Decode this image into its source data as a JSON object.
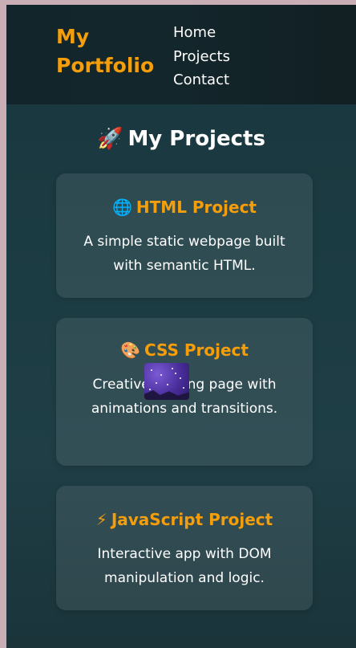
{
  "header": {
    "brand_line1": "My",
    "brand_line2": "Portfolio",
    "nav": [
      "Home",
      "Projects",
      "Contact"
    ]
  },
  "page": {
    "title_emoji": "🚀",
    "title": "My Projects"
  },
  "projects": [
    {
      "emoji": "🌐",
      "title": "HTML Project",
      "description": "A simple static webpage built with semantic HTML."
    },
    {
      "emoji": "🎨",
      "title": "CSS Project",
      "description": "Creative landing page with animations and transitions."
    },
    {
      "emoji": "⚡",
      "title": "JavaScript Project",
      "description": "Interactive app with DOM manipulation and logic."
    }
  ],
  "colors": {
    "accent": "#f59e0b",
    "background": "#1b3b42",
    "header_bg": "#13262b",
    "card_bg": "rgba(255,255,255,0.09)",
    "text": "#ffffff",
    "outer_bg": "#c9aeb6"
  },
  "overlay": {
    "icon": "galaxy-image-icon"
  }
}
